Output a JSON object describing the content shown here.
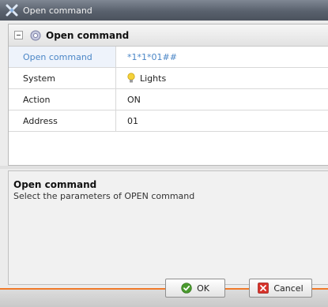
{
  "window": {
    "title": "Open command"
  },
  "group": {
    "title": "Open command"
  },
  "properties": [
    {
      "name": "Open command",
      "value": "*1*1*01##",
      "selected": true
    },
    {
      "name": "System",
      "value": "Lights",
      "icon": "bulb-icon"
    },
    {
      "name": "Action",
      "value": "ON"
    },
    {
      "name": "Address",
      "value": "01"
    }
  ],
  "description": {
    "title": "Open command",
    "text": "Select the parameters of OPEN command"
  },
  "buttons": {
    "ok_label": "OK",
    "cancel_label": "Cancel"
  },
  "colors": {
    "accent": "#f07a2a",
    "selected_text": "#4b86c6"
  }
}
